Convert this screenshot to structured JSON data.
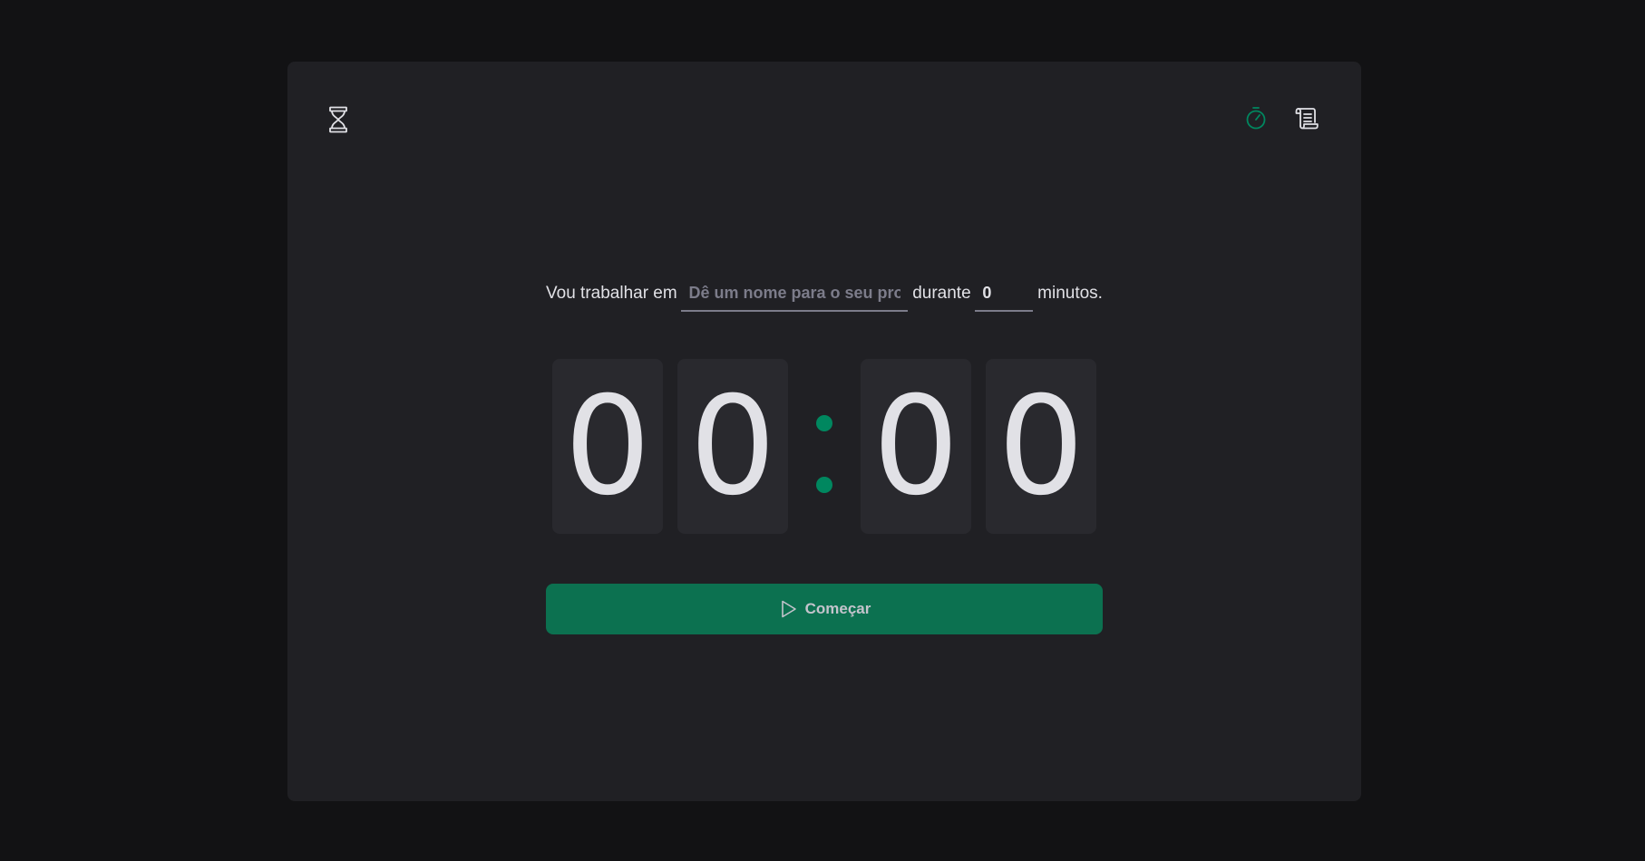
{
  "header": {
    "logo_icon": "hourglass-icon",
    "nav": [
      {
        "icon": "timer-icon",
        "active": true
      },
      {
        "icon": "scroll-icon",
        "active": false
      }
    ]
  },
  "form": {
    "task_prefix": "Vou trabalhar em",
    "task_placeholder": "Dê um nome para o seu projeto",
    "duration_label": "durante",
    "minutes_value": "0",
    "minutes_suffix": "minutos."
  },
  "countdown": {
    "minutes_tens": "0",
    "minutes_ones": "0",
    "seconds_tens": "0",
    "seconds_ones": "0"
  },
  "start_button": {
    "label": "Começar",
    "icon": "play-icon"
  },
  "colors": {
    "background": "#121214",
    "card": "#202024",
    "digit_box": "#29292e",
    "accent": "#00875f",
    "button": "#0c7150",
    "text": "#e1e1e6",
    "placeholder": "#7c7c8a"
  }
}
